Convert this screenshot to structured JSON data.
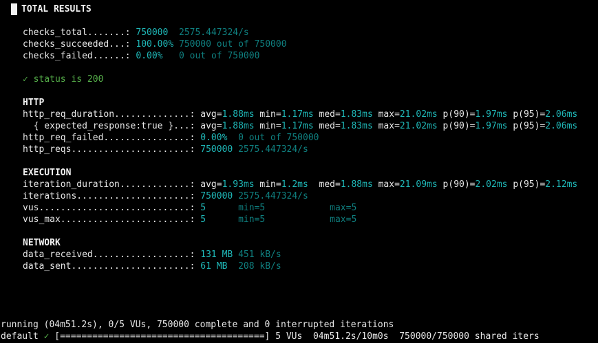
{
  "title": "TOTAL RESULTS",
  "checks": [
    {
      "name": "checks_total",
      "dots": ".......:",
      "value": "750000",
      "extra": "2575.447324/s",
      "gap": "  "
    },
    {
      "name": "checks_succeeded",
      "dots": "...:",
      "value": "100.00%",
      "extra": "750000 out of 750000",
      "gap": " "
    },
    {
      "name": "checks_failed",
      "dots": "......:",
      "value": "0.00%",
      "extra": "0 out of 750000",
      "gap": "   "
    }
  ],
  "status_check": "✓ status is 200",
  "http": {
    "header": "HTTP",
    "req_duration": {
      "name": "http_req_duration..............:",
      "avg": "1.88ms",
      "min": "1.17ms",
      "med": "1.83ms",
      "max": "21.02ms",
      "p90": "1.97ms",
      "p95": "2.06ms"
    },
    "expected": {
      "name": "  { expected_response:true }...:",
      "avg": "1.88ms",
      "min": "1.17ms",
      "med": "1.83ms",
      "max": "21.02ms",
      "p90": "1.97ms",
      "p95": "2.06ms"
    },
    "req_failed": {
      "name": "http_req_failed................:",
      "value": "0.00%",
      "extra": "0 out of 750000"
    },
    "reqs": {
      "name": "http_reqs......................:",
      "value": "750000",
      "extra": "2575.447324/s"
    }
  },
  "execution": {
    "header": "EXECUTION",
    "iteration_duration": {
      "name": "iteration_duration.............:",
      "avg": "1.93ms",
      "min": "1.2ms",
      "med": "1.88ms",
      "max": "21.09ms",
      "p90": "2.02ms",
      "p95": "2.12ms"
    },
    "iterations": {
      "name": "iterations.....................:",
      "value": "750000",
      "extra": "2575.447324/s"
    },
    "vus": {
      "name": "vus............................:",
      "value": "5",
      "min": "min=5",
      "max": "max=5"
    },
    "vus_max": {
      "name": "vus_max........................:",
      "value": "5",
      "min": "min=5",
      "max": "max=5"
    }
  },
  "network": {
    "header": "NETWORK",
    "received": {
      "name": "data_received..................:",
      "value": "131 MB",
      "extra": "451 kB/s"
    },
    "sent": {
      "name": "data_sent......................:",
      "value": "61 MB",
      "extra": "208 kB/s"
    }
  },
  "footer": {
    "running": "running (04m51.2s), 0/5 VUs, 750000 complete and 0 interrupted iterations",
    "scenario": "default",
    "check": "✓",
    "bar": "[======================================]",
    "vus": "5 VUs",
    "time": "04m51.2s/10m0s",
    "iters": "750000/750000 shared iters"
  },
  "labels": {
    "avg": "avg=",
    "min": "min=",
    "med": "med=",
    "max": "max=",
    "p90": "p(90)=",
    "p95": "p(95)="
  }
}
